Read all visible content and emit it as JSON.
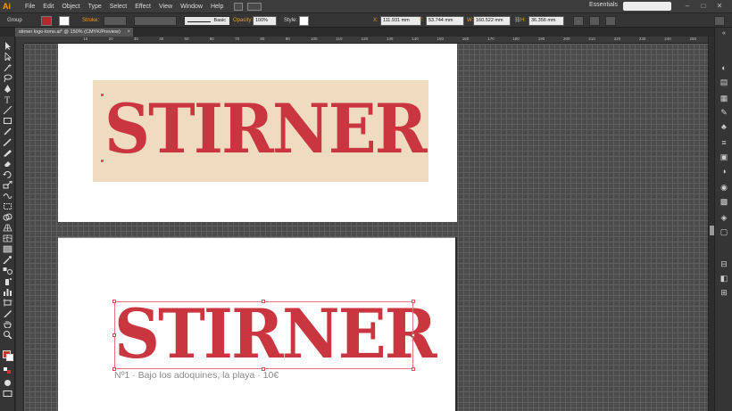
{
  "app": {
    "logo": "Ai"
  },
  "menu": [
    "File",
    "Edit",
    "Object",
    "Type",
    "Select",
    "Effect",
    "View",
    "Window",
    "Help"
  ],
  "workspace": {
    "label": "Essentials"
  },
  "window_controls": {
    "minimize": "–",
    "restore": "□",
    "close": "✕"
  },
  "control_bar": {
    "selection": "Group",
    "fill_color": "#b3282d",
    "stroke_label": "Stroke:",
    "brush": "Basic",
    "opacity_label": "Opacity:",
    "opacity_value": "100%",
    "style_label": "Style:",
    "x_label": "X:",
    "x_value": "111.931 mm",
    "y_label": "Y:",
    "y_value": "53.744 mm",
    "w_label": "W:",
    "w_value": "160.522 mm",
    "h_label": "H:",
    "h_value": "36.356 mm"
  },
  "document": {
    "tab_title": "stirner logo-lomo.ai* @ 150% (CMYK/Preview)",
    "close": "×"
  },
  "ruler_ticks": [
    "10",
    "20",
    "30",
    "40",
    "50",
    "60",
    "70",
    "80",
    "90",
    "100",
    "110",
    "120",
    "130",
    "140",
    "150",
    "160",
    "170",
    "180",
    "190",
    "200",
    "210",
    "220",
    "230",
    "240",
    "250",
    "260",
    "270"
  ],
  "artwork": {
    "logo_text_top": "STIRNER",
    "logo_text_bottom": "STIRNER",
    "caption": "Nº1 · Bajo los adoquines, la playa · 10€",
    "logo_color": "#c9363f",
    "background_color": "#efdbc0"
  }
}
